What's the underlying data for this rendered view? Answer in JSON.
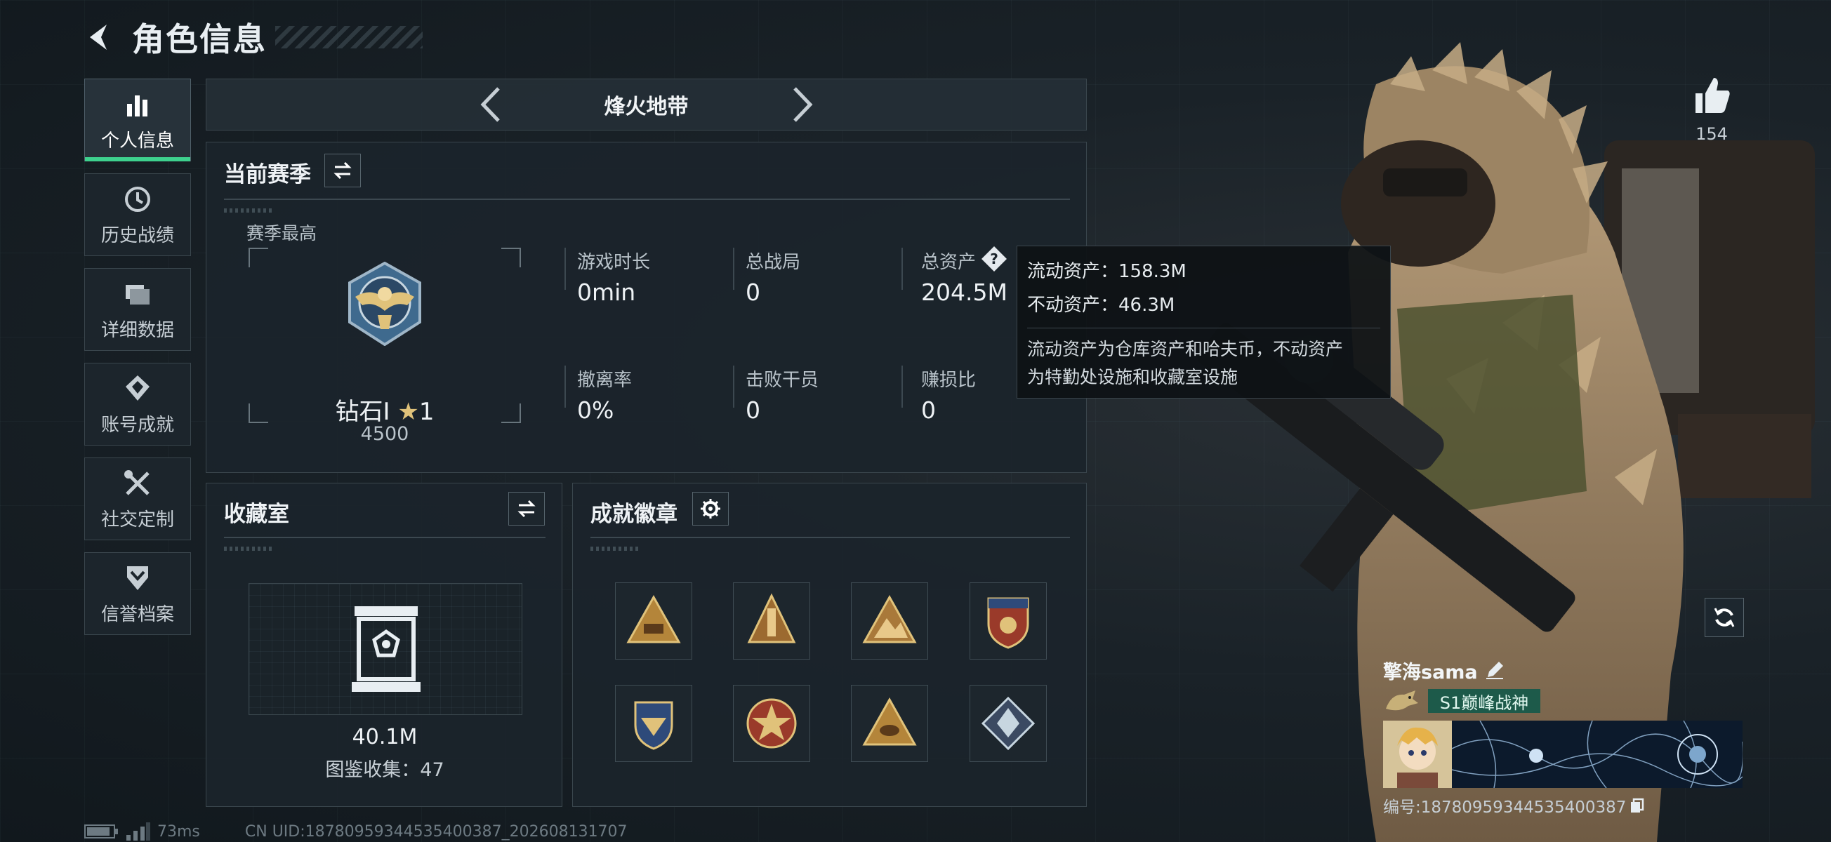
{
  "header": {
    "title": "角色信息"
  },
  "sidebar": {
    "items": [
      {
        "label": "个人信息",
        "icon": "bar-chart-icon",
        "active": true
      },
      {
        "label": "历史战绩",
        "icon": "history-clock-icon"
      },
      {
        "label": "详细数据",
        "icon": "folder-stack-icon"
      },
      {
        "label": "账号成就",
        "icon": "medal-icon"
      },
      {
        "label": "社交定制",
        "icon": "tools-icon"
      },
      {
        "label": "信誉档案",
        "icon": "shield-chevron-icon"
      }
    ]
  },
  "mode_selector": {
    "name": "烽火地带"
  },
  "season": {
    "title": "当前赛季",
    "best_label": "赛季最高",
    "rank_name": "钻石I",
    "rank_stars": "1",
    "rank_score": "4500",
    "stats": [
      {
        "label": "游戏时长",
        "value": "0min"
      },
      {
        "label": "总战局",
        "value": "0"
      },
      {
        "label": "总资产",
        "value": "204.5M"
      },
      {
        "label": "撤离率",
        "value": "0%"
      },
      {
        "label": "击败干员",
        "value": "0"
      },
      {
        "label": "赚损比",
        "value": "0"
      }
    ]
  },
  "tooltip": {
    "liquid": "流动资产：158.3M",
    "fixed": "不动资产：46.3M",
    "desc_line1": "流动资产为仓库资产和哈夫币，不动资产",
    "desc_line2": "为特勤处设施和收藏室设施"
  },
  "collection": {
    "title": "收藏室",
    "value": "40.1M",
    "count_text": "图鉴收集：47"
  },
  "badges": {
    "title": "成就徽章",
    "items": [
      "pyramid-badge-icon",
      "tower-badge-icon",
      "mountain-badge-icon",
      "shield-star-badge-icon",
      "crest-badge-icon",
      "star-medal-badge-icon",
      "eye-triangle-badge-icon",
      "diamond-badge-icon"
    ]
  },
  "likes": {
    "count": "154"
  },
  "profile": {
    "name": "擎海sama",
    "title_tag": "S1巅峰战神",
    "uid_text": "编号:18780959344535400387"
  },
  "footer": {
    "latency": "73ms",
    "uid_line": "CN UID:18780959344535400387_202608131707"
  },
  "colors": {
    "accent_green": "#3ed18e",
    "panel_bg": "#1b242b",
    "border": "#3a464d"
  }
}
